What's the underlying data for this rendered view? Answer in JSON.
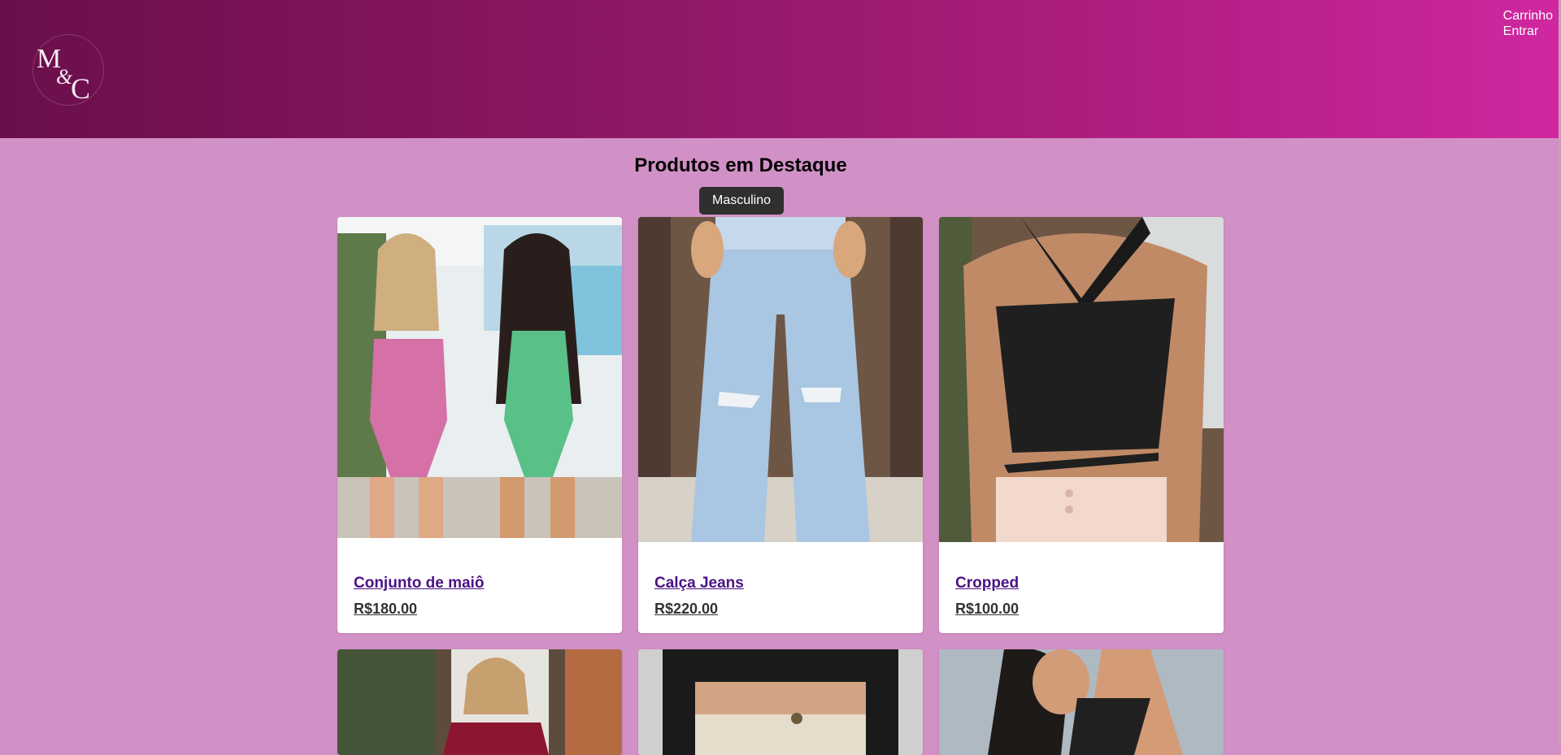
{
  "header": {
    "logo_text": "M&C",
    "links": {
      "cart": "Carrinho",
      "login": "Entrar"
    },
    "gradient": [
      "#6a0f4a",
      "#d027a0"
    ]
  },
  "main": {
    "title": "Produtos em Destaque",
    "filter_label": "Masculino"
  },
  "products": [
    {
      "name": "Conjunto de maiô",
      "price": "R$180.00"
    },
    {
      "name": "Calça Jeans",
      "price": "R$220.00"
    },
    {
      "name": "Cropped",
      "price": "R$100.00"
    }
  ],
  "colors": {
    "page_bg": "#d291c6",
    "link": "#4b1286",
    "button": "#2f2f2f"
  }
}
